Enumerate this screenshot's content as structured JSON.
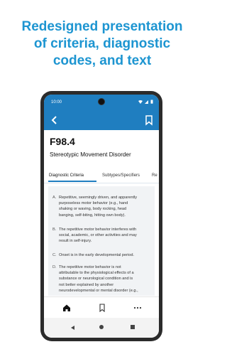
{
  "headline": {
    "line1": "Redesigned presentation",
    "line2": "of criteria, diagnostic",
    "line3": "codes, and text"
  },
  "status_bar": {
    "time": "10:00"
  },
  "diagnosis": {
    "code": "F98.4",
    "name": "Stereotypic Movement Disorder"
  },
  "tabs": [
    {
      "label": "Diagnostic Criteria",
      "active": true
    },
    {
      "label": "Subtypes/Specifiers",
      "active": false
    },
    {
      "label": "Re",
      "active": false
    }
  ],
  "criteria": [
    {
      "letter": "A.",
      "lines": [
        "Repetitive, seemingly driven, and apparently",
        "purposeless motor behavior (e.g., hand",
        "shaking or waving, body rocking, head",
        "banging, self-biting, hitting own body)."
      ]
    },
    {
      "letter": "B.",
      "lines": [
        "The repetitive motor behavior interferes with",
        "social, academic, or other activities and may",
        "result in self-injury."
      ]
    },
    {
      "letter": "C.",
      "lines": [
        "Onset is in the early developmental period."
      ]
    },
    {
      "letter": "D.",
      "lines": [
        "The repetitive motor behavior is not",
        "attributable to the physiological effects of a",
        "substance or neurological condition and is",
        "not better explained by another",
        "neurodevelopmental or mental disorder (e.g.,"
      ]
    }
  ],
  "bottom_nav": [
    {
      "icon": "home-icon"
    },
    {
      "icon": "bookmark-icon"
    },
    {
      "icon": "more-icon"
    }
  ],
  "colors": {
    "accent": "#1f7ec0",
    "headline": "#1d95d1"
  }
}
